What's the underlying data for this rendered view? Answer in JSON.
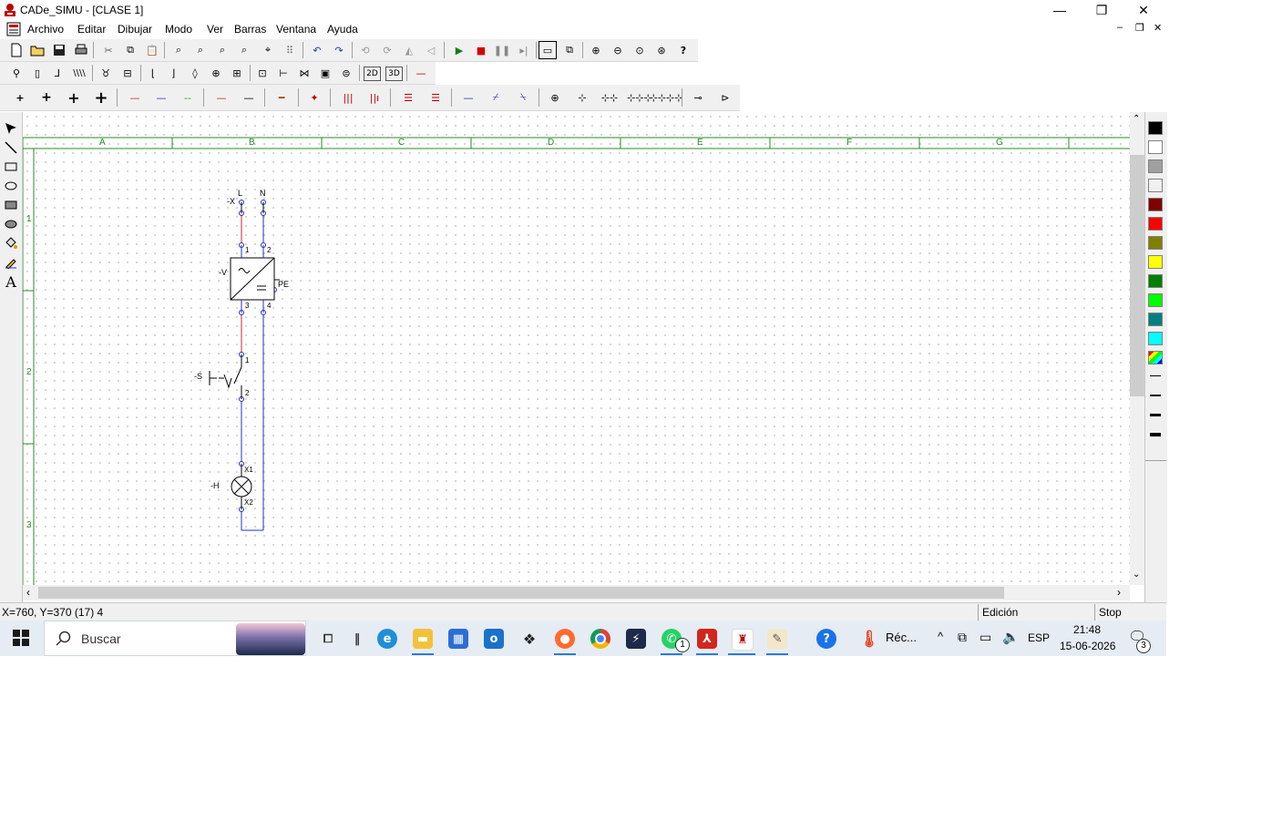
{
  "window": {
    "title": "CADe_SIMU - [CLASE 1]",
    "controls": {
      "minimize": "—",
      "maximize": "❐",
      "close": "✕"
    },
    "mdi_controls": {
      "minimize": "–",
      "restore": "❐",
      "close": "✕"
    }
  },
  "menubar": {
    "items": [
      "Archivo",
      "Editar",
      "Dibujar",
      "Modo",
      "Ver",
      "Barras",
      "Ventana",
      "Ayuda"
    ]
  },
  "toolbar1": {
    "icons": [
      "new-file-icon",
      "open-folder-icon",
      "save-icon",
      "print-icon",
      "cut-icon",
      "copy-icon",
      "paste-icon",
      "find-icon",
      "find-next-icon",
      "replace-icon",
      "search-zoom-icon",
      "goto-icon",
      "grid-icon",
      "undo-icon",
      "redo-icon",
      "rotate-left-icon",
      "rotate-right-icon",
      "mirror-h-icon",
      "mirror-v-icon",
      "play-icon",
      "stop-icon",
      "pause-icon",
      "step-icon",
      "window-select-icon",
      "window-zoom-icon",
      "zoom-in-icon",
      "zoom-out-icon",
      "zoom-fit-icon",
      "zoom-window-icon",
      "help-icon"
    ]
  },
  "toolbar2": {
    "icons": [
      "probe-icon",
      "fuse-icon",
      "breaker-icon",
      "three-pole-breaker-icon",
      "motor-protector-icon",
      "relay-icon",
      "switch-no-icon",
      "switch-nc-icon",
      "coil-icon",
      "lamp-icon",
      "pump-icon",
      "transformer-icon",
      "terminal-icon",
      "valve-icon",
      "contactor-icon",
      "sensor-icon",
      "2d-label-icon",
      "3d-label-icon",
      "line-icon"
    ],
    "labels": {
      "2d": "2D",
      "3d": "3D"
    }
  },
  "toolbar3": {
    "icons": [
      "junction-1-icon",
      "junction-2-icon",
      "junction-3-icon",
      "junction-4-icon",
      "wire-red-icon",
      "wire-blue-icon",
      "wire-green-icon",
      "wire-red2-icon",
      "wire-black-icon",
      "wire-thick-icon",
      "node-icon",
      "bus-3-icon",
      "bus-4-icon",
      "bus-h3-icon",
      "bus-h4-icon",
      "conductor-1-icon",
      "conductor-2-icon",
      "conductor-3-icon",
      "terminal-strip-1-icon",
      "terminal-strip-2-icon",
      "terminal-strip-3-icon",
      "terminal-strip-4-icon",
      "terminal-strip-5-icon",
      "connector-1-icon",
      "connector-2-icon"
    ]
  },
  "draw_tools": [
    "select-arrow-icon",
    "line-tool-icon",
    "rectangle-tool-icon",
    "ellipse-tool-icon",
    "filled-rectangle-tool-icon",
    "filled-ellipse-tool-icon",
    "fill-bucket-icon",
    "pencil-icon",
    "text-tool-icon"
  ],
  "text_tool_glyph": "A",
  "palette": {
    "colors": [
      "#000000",
      "#ffffff",
      "#a0a0a0",
      "#f0f0f0",
      "#800000",
      "#ff0000",
      "#808000",
      "#ffff00",
      "#008000",
      "#00ff00",
      "#008080",
      "#00ffff"
    ],
    "line_widths": [
      1,
      2,
      3,
      4
    ]
  },
  "sheet": {
    "columns": [
      "A",
      "B",
      "C",
      "D",
      "E",
      "F",
      "G"
    ],
    "rows": [
      "1",
      "2",
      "3"
    ]
  },
  "schematic": {
    "terminal_prefix": "-X",
    "terminal_labels": [
      "L",
      "N"
    ],
    "converter_tag": "-V",
    "converter_pins": [
      "1",
      "2",
      "3",
      "4"
    ],
    "pe_label": "PE",
    "switch_tag": "-S",
    "switch_pins": [
      "1",
      "2"
    ],
    "lamp_tag": "-H",
    "lamp_pins": [
      "X1",
      "X2"
    ],
    "colors": {
      "phase": "#d02020",
      "neutral": "#2030c0",
      "grid": "#2a8a2a"
    }
  },
  "statusbar": {
    "coords": "X=760, Y=370 (17) 4",
    "mode": "Edición",
    "state": "Stop"
  },
  "taskbar": {
    "search_placeholder": "Buscar",
    "weather_text": "Réc...",
    "language": "ESP",
    "time": "21:48",
    "date": "15-06-2026",
    "whatsapp_badge": "1",
    "notification_badge": "3",
    "apps": [
      "windows-start-icon",
      "task-view-icon",
      "widgets-icon",
      "edge-icon",
      "file-explorer-icon",
      "store-icon",
      "outlook-icon",
      "dropbox-icon",
      "firefox-icon",
      "chrome-icon",
      "terminal-icon",
      "whatsapp-icon",
      "acrobat-icon",
      "cadesimu-icon",
      "paint-icon",
      "help-app-icon",
      "weather-icon"
    ]
  }
}
